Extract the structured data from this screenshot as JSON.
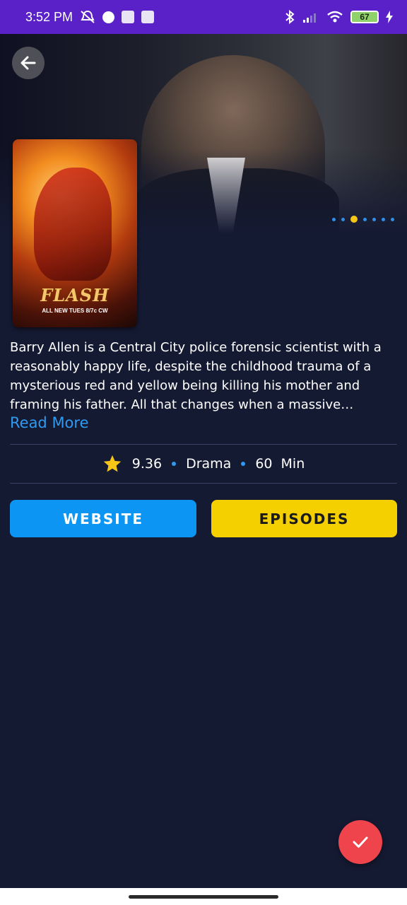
{
  "status_bar": {
    "time": "3:52 PM",
    "battery": "67"
  },
  "show": {
    "poster_title": "FLASH",
    "poster_tagline": "ALL NEW TUES 8/7c CW",
    "description": "Barry Allen is a Central City police forensic scientist with a reasonably happy life, despite the childhood trauma of a mysterious red and yellow being killing his mother and framing his father. All that changes when a massive…",
    "read_more_label": "Read More",
    "rating": "9.36",
    "genre": "Drama",
    "runtime_value": "60",
    "runtime_unit": "Min"
  },
  "carousel": {
    "dot_count": 7,
    "active_index": 2
  },
  "buttons": {
    "website_label": "WEBSITE",
    "episodes_label": "EPISODES"
  },
  "colors": {
    "background": "#151a33",
    "status_bar": "#5a21c9",
    "accent_blue": "#0d95f4",
    "accent_yellow": "#f5d000",
    "fab_red": "#f0444d",
    "star_yellow": "#f5c518"
  }
}
